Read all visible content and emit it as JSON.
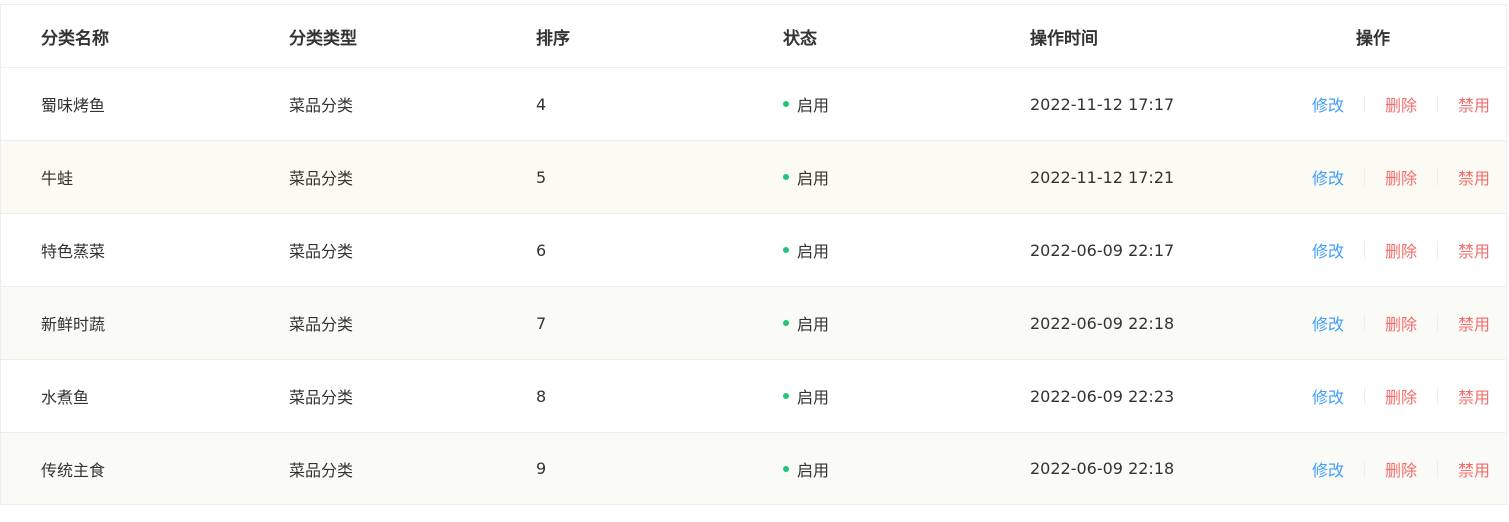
{
  "table": {
    "headers": [
      "分类名称",
      "分类类型",
      "排序",
      "状态",
      "操作时间",
      "操作"
    ],
    "rows": [
      {
        "name": "蜀味烤鱼",
        "type": "菜品分类",
        "sort": "4",
        "status": "启用",
        "time": "2022-11-12 17:17",
        "edit": "修改",
        "delete": "删除",
        "disable": "禁用"
      },
      {
        "name": "牛蛙",
        "type": "菜品分类",
        "sort": "5",
        "status": "启用",
        "time": "2022-11-12 17:21",
        "edit": "修改",
        "delete": "删除",
        "disable": "禁用"
      },
      {
        "name": "特色蒸菜",
        "type": "菜品分类",
        "sort": "6",
        "status": "启用",
        "time": "2022-06-09 22:17",
        "edit": "修改",
        "delete": "删除",
        "disable": "禁用"
      },
      {
        "name": "新鲜时蔬",
        "type": "菜品分类",
        "sort": "7",
        "status": "启用",
        "time": "2022-06-09 22:18",
        "edit": "修改",
        "delete": "删除",
        "disable": "禁用"
      },
      {
        "name": "水煮鱼",
        "type": "菜品分类",
        "sort": "8",
        "status": "启用",
        "time": "2022-06-09 22:23",
        "edit": "修改",
        "delete": "删除",
        "disable": "禁用"
      },
      {
        "name": "传统主食",
        "type": "菜品分类",
        "sort": "9",
        "status": "启用",
        "time": "2022-06-09 22:18",
        "edit": "修改",
        "delete": "删除",
        "disable": "禁用"
      }
    ]
  },
  "colors": {
    "status_enabled": "#22c37a",
    "edit_link": "#419eff",
    "delete_link": "#f56c6c",
    "disable_link": "#f56c6c"
  }
}
